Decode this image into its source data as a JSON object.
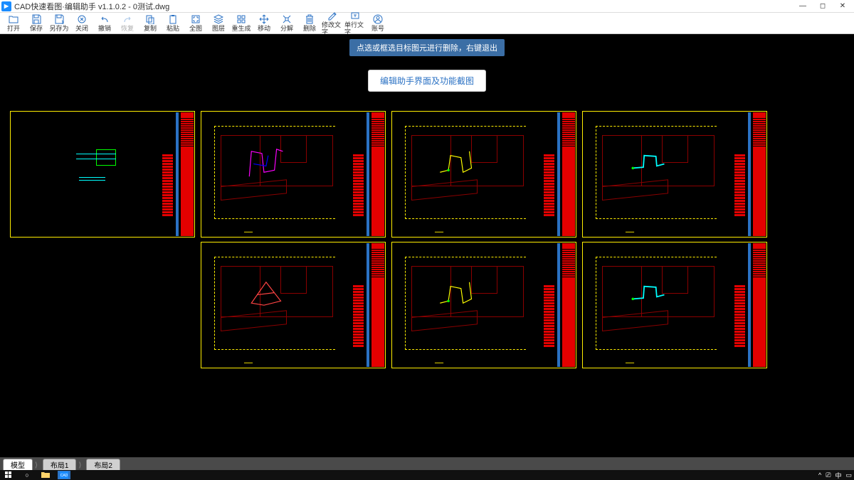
{
  "title": "CAD快速看图·编辑助手 v1.1.0.2 - 0测试.dwg",
  "win_controls": {
    "min": "—",
    "max": "◻",
    "close": "✕"
  },
  "toolbar": [
    {
      "id": "open",
      "label": "打开"
    },
    {
      "id": "save",
      "label": "保存"
    },
    {
      "id": "saveas",
      "label": "另存为"
    },
    {
      "id": "close",
      "label": "关闭"
    },
    {
      "id": "undo",
      "label": "撤销"
    },
    {
      "id": "redo",
      "label": "恢复",
      "disabled": true
    },
    {
      "id": "copy",
      "label": "复制"
    },
    {
      "id": "paste",
      "label": "粘贴"
    },
    {
      "id": "full",
      "label": "全图"
    },
    {
      "id": "layer",
      "label": "图层"
    },
    {
      "id": "regen",
      "label": "重生成"
    },
    {
      "id": "move",
      "label": "移动"
    },
    {
      "id": "explode",
      "label": "分解"
    },
    {
      "id": "delete",
      "label": "删除"
    },
    {
      "id": "edittext",
      "label": "修改文字"
    },
    {
      "id": "text",
      "label": "单行文字"
    },
    {
      "id": "account",
      "label": "账号"
    }
  ],
  "tooltip": "点选或框选目标图元进行删除，右键退出",
  "btn_screenshot": "编辑助手界面及功能截图",
  "tabs": {
    "model": "模型",
    "layout1": "布局1",
    "layout2": "布局2"
  },
  "sheets": [
    {
      "overlay": "legend"
    },
    {
      "overlay": "magenta"
    },
    {
      "overlay": "yellow"
    },
    {
      "overlay": "cyan"
    },
    {
      "overlay": "red"
    },
    {
      "overlay": "yellow2"
    },
    {
      "overlay": "cyan2"
    }
  ],
  "tray": {
    "chevron": "^",
    "im": "中"
  }
}
